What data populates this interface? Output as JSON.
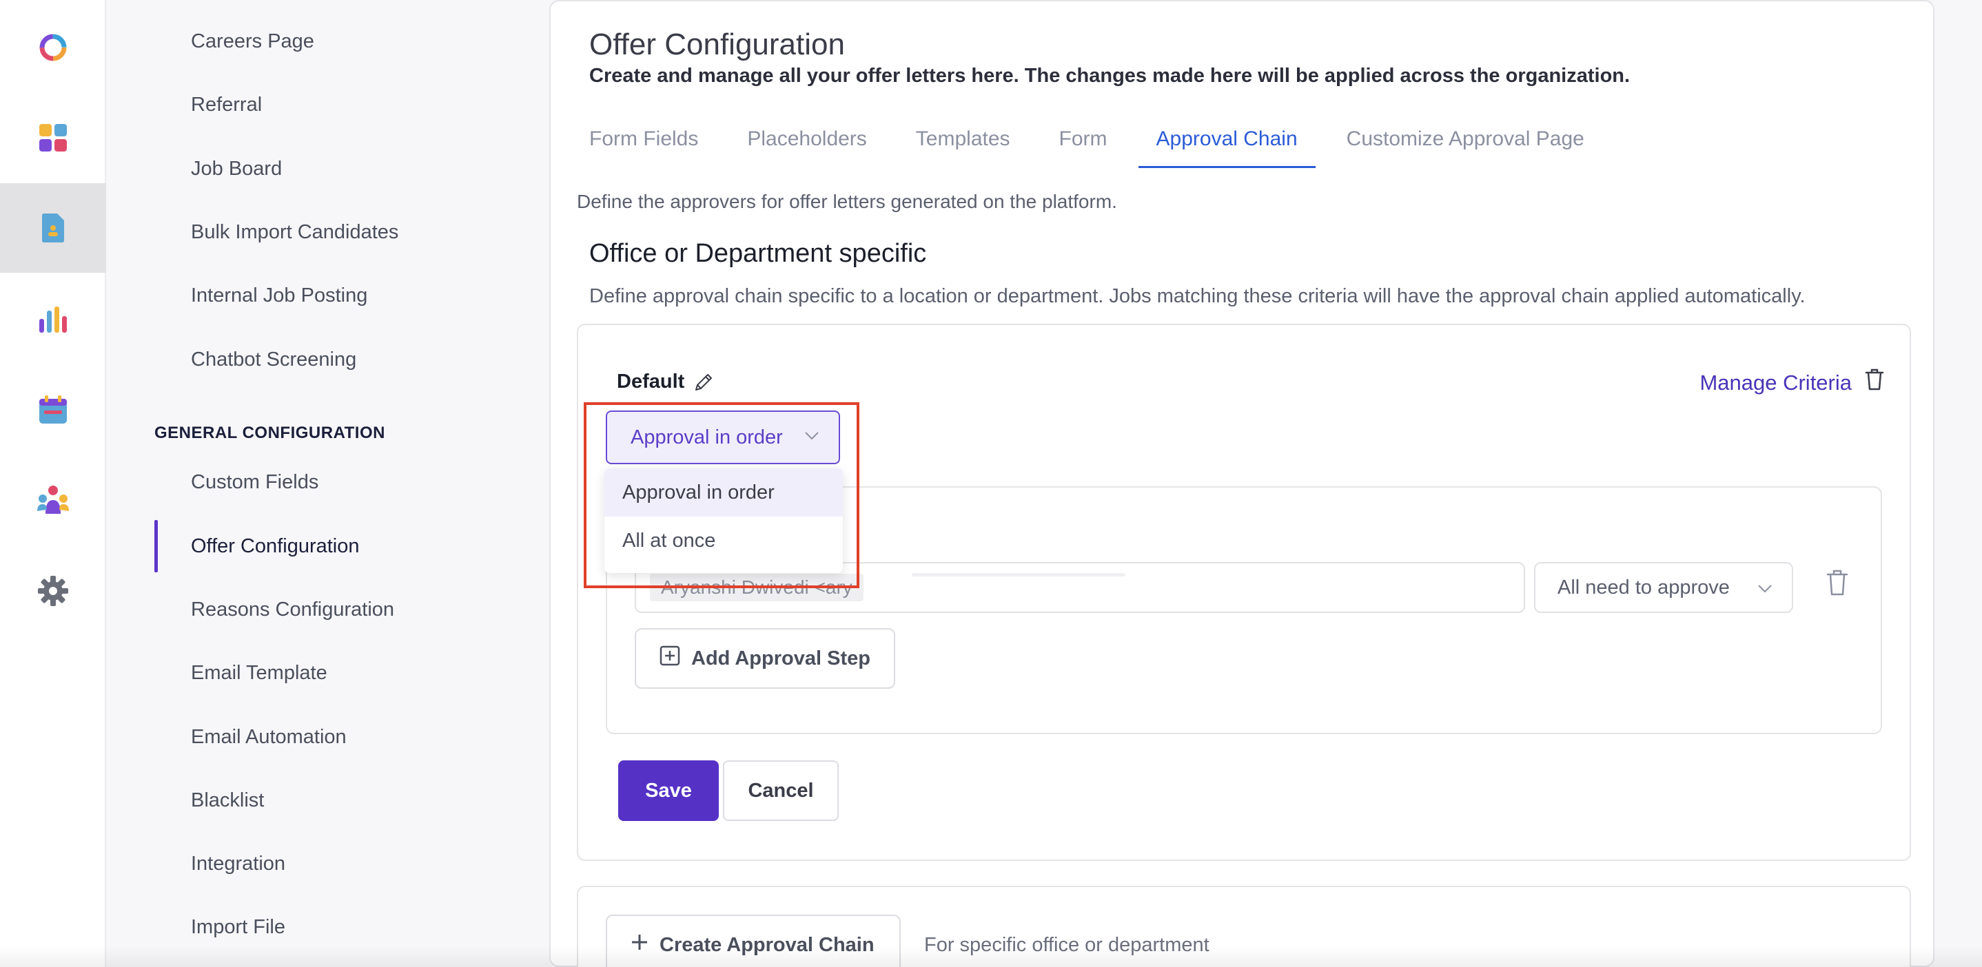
{
  "rail": {
    "icons": [
      "app-logo-icon",
      "dashboard-icon",
      "document-icon",
      "analytics-icon",
      "calendar-icon",
      "team-icon",
      "settings-icon"
    ]
  },
  "subnav": {
    "items_top": [
      "Careers Page",
      "Referral",
      "Job Board",
      "Bulk Import Candidates",
      "Internal Job Posting",
      "Chatbot Screening"
    ],
    "section_label": "GENERAL CONFIGURATION",
    "items_general": [
      "Custom Fields",
      "Offer Configuration",
      "Reasons Configuration",
      "Email Template",
      "Email Automation",
      "Blacklist",
      "Integration",
      "Import File"
    ]
  },
  "page": {
    "title": "Offer Configuration",
    "subtitle": "Create and manage all your offer letters here. The changes made here will be applied across the organization.",
    "tabs": [
      "Form Fields",
      "Placeholders",
      "Templates",
      "Form",
      "Approval Chain",
      "Customize Approval Page"
    ],
    "active_tab": "Approval Chain",
    "define_text": "Define the approvers for offer letters generated on the platform.",
    "section_title": "Office or Department specific",
    "section_desc": "Define approval chain specific to a location or department. Jobs matching these criteria will have the approval chain applied automatically."
  },
  "default_card": {
    "label": "Default",
    "manage_criteria": "Manage Criteria",
    "approval_type": "Approval in order",
    "menu_options": [
      "Approval in order",
      "All at once"
    ],
    "approver_chip": "Aryanshi Dwivedi <ary",
    "approval_mode": "All need to approve",
    "add_step": "Add Approval Step",
    "save": "Save",
    "cancel": "Cancel"
  },
  "create_card": {
    "button": "Create Approval Chain",
    "hint": "For specific office or department"
  },
  "colors": {
    "accent": "#5531c5",
    "tab_active": "#2b5bd7",
    "highlight": "#e0402a"
  }
}
